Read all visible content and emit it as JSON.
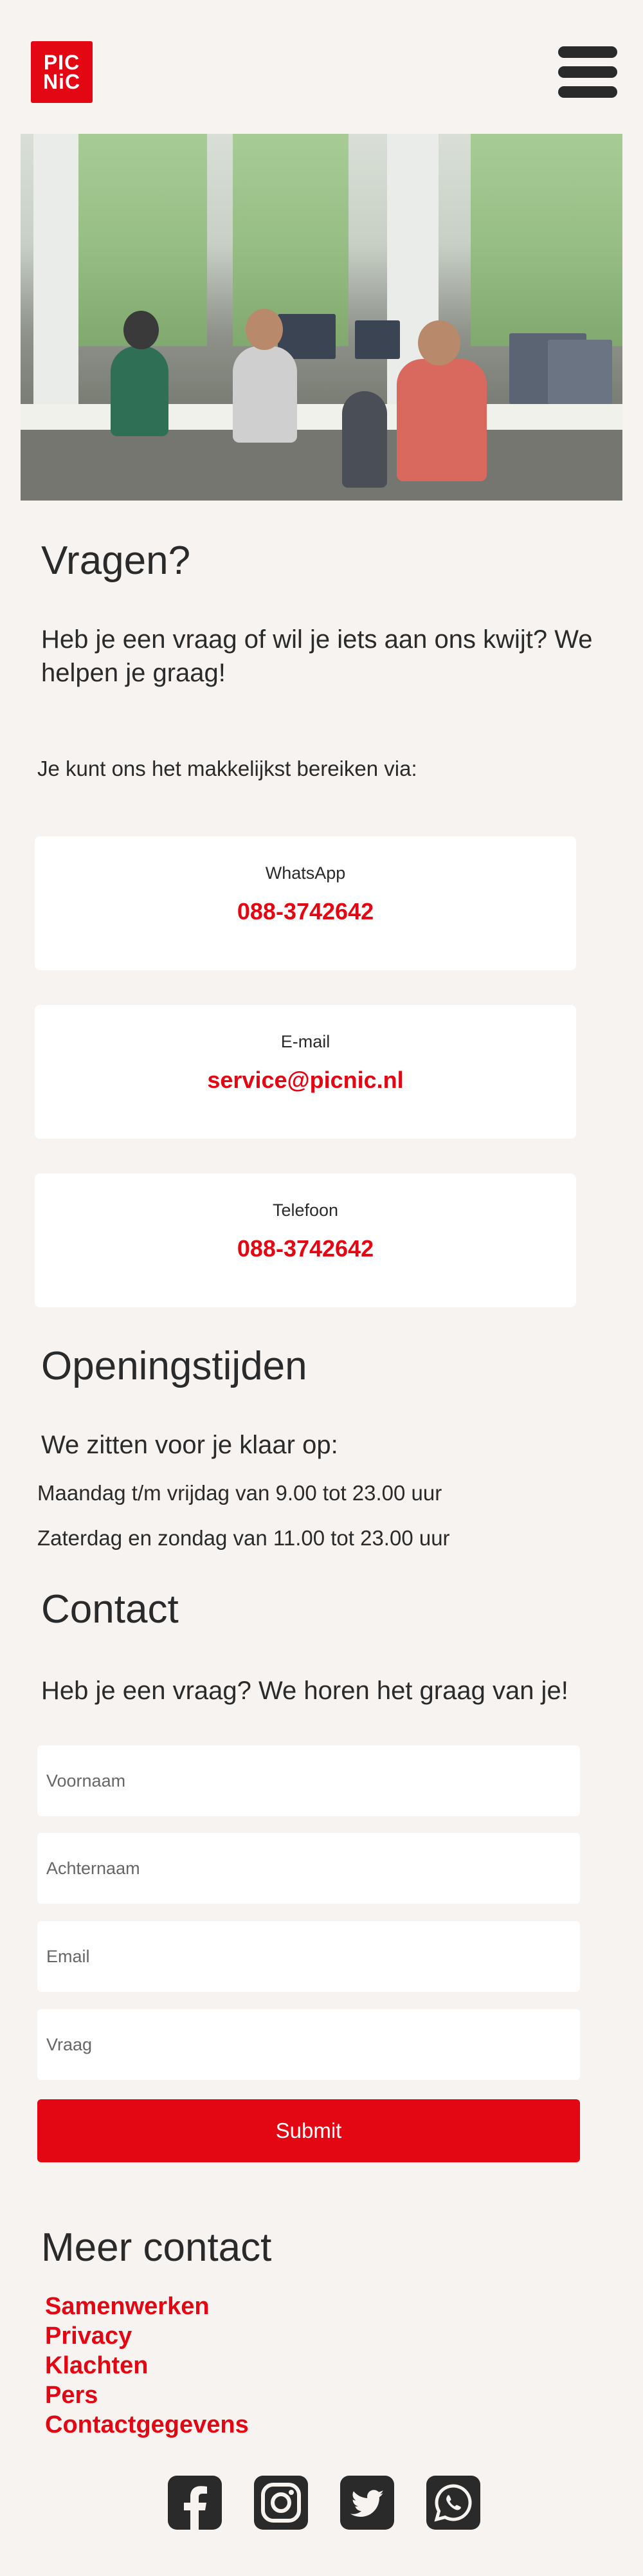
{
  "brand": {
    "logo_line1": "PIC",
    "logo_line2": "NiC",
    "accent": "#e30613"
  },
  "intro": {
    "title": "Vragen?",
    "lead": "Heb je een vraag of wil je iets aan ons kwijt? We helpen je graag!",
    "reach": "Je kunt ons het makkelijkst bereiken via:"
  },
  "channels": [
    {
      "label": "WhatsApp",
      "value": "088-3742642"
    },
    {
      "label": "E-mail",
      "value": "service@picnic.nl"
    },
    {
      "label": "Telefoon",
      "value": "088-3742642"
    }
  ],
  "hours": {
    "title": "Openingstijden",
    "lead": "We zitten voor je klaar op:",
    "weekdays": "Maandag t/m vrijdag van 9.00 tot 23.00 uur",
    "weekend": "Zaterdag en zondag van 11.00 tot 23.00 uur"
  },
  "contact": {
    "title": "Contact",
    "lead": "Heb je een vraag? We horen het graag van je!",
    "first_name_placeholder": "Voornaam",
    "last_name_placeholder": "Achternaam",
    "email_placeholder": "Email",
    "question_placeholder": "Vraag",
    "submit_label": "Submit"
  },
  "more": {
    "title": "Meer contact",
    "links": [
      "Samenwerken",
      "Privacy",
      "Klachten",
      "Pers",
      "Contactgegevens"
    ]
  },
  "social_icons": [
    "facebook-icon",
    "instagram-icon",
    "twitter-icon",
    "whatsapp-icon"
  ]
}
